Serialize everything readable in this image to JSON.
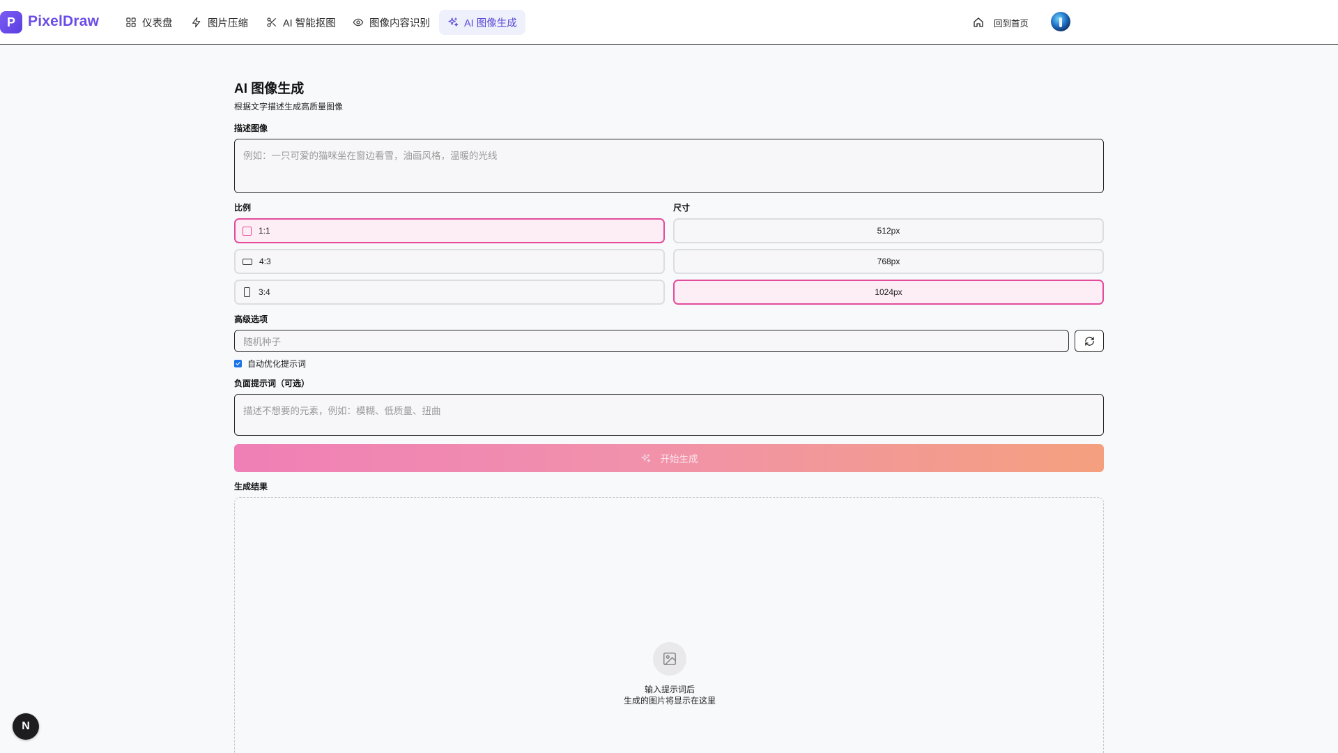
{
  "brand": {
    "logo_letter": "P",
    "name": "PixelDraw"
  },
  "nav": {
    "items": [
      {
        "label": "仪表盘",
        "icon": "grid-icon"
      },
      {
        "label": "图片压缩",
        "icon": "zap-icon"
      },
      {
        "label": "AI 智能抠图",
        "icon": "scissors-icon"
      },
      {
        "label": "图像内容识别",
        "icon": "eye-icon"
      },
      {
        "label": "AI 图像生成",
        "icon": "sparkles-icon",
        "active": true
      }
    ],
    "home_label": "回到首页"
  },
  "page": {
    "title": "AI 图像生成",
    "subtitle": "根据文字描述生成高质量图像"
  },
  "form": {
    "prompt_label": "描述图像",
    "prompt_placeholder": "例如：一只可爱的猫咪坐在窗边看雪，油画风格，温暖的光线",
    "ratio_label": "比例",
    "ratios": [
      {
        "label": "1:1",
        "selected": true
      },
      {
        "label": "4:3",
        "selected": false
      },
      {
        "label": "3:4",
        "selected": false
      }
    ],
    "size_label": "尺寸",
    "sizes": [
      {
        "label": "512px",
        "selected": false
      },
      {
        "label": "768px",
        "selected": false
      },
      {
        "label": "1024px",
        "selected": true
      }
    ],
    "advanced_label": "高级选项",
    "seed_placeholder": "随机种子",
    "auto_optimize_label": "自动优化提示词",
    "auto_optimize_checked": true,
    "negative_label": "负面提示词（可选）",
    "negative_placeholder": "描述不想要的元素，例如：模糊、低质量、扭曲",
    "generate_label": "开始生成"
  },
  "result": {
    "label": "生成结果",
    "empty_line1": "输入提示词后",
    "empty_line2": "生成的图片将显示在这里"
  },
  "floating_badge": "N",
  "colors": {
    "brand": "#6b4ce6",
    "selected_border": "#e34b9b",
    "selected_bg": "#fdeef6",
    "nav_active_bg": "#eef0fb",
    "gradient_start": "#ef7fb6",
    "gradient_end": "#f4a07f"
  }
}
